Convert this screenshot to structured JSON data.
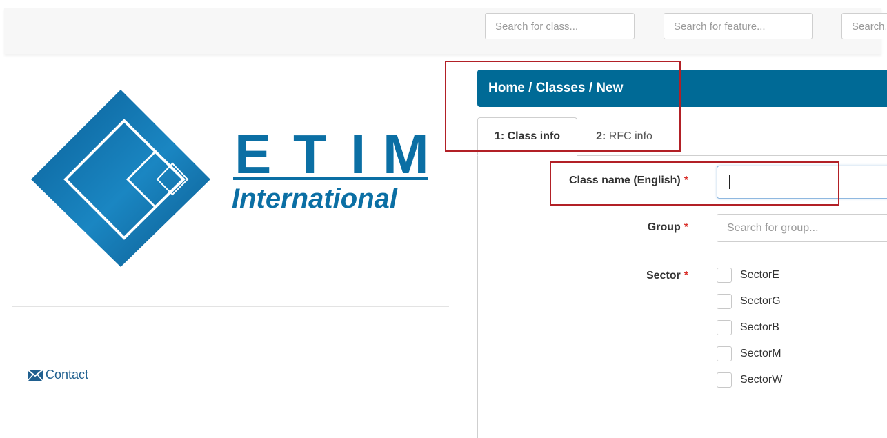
{
  "top_search": {
    "class_placeholder": "Search for class...",
    "feature_placeholder": "Search for feature...",
    "third_placeholder": "Search..."
  },
  "logo": {
    "letters": [
      "E",
      "T",
      "I",
      "M"
    ],
    "subtitle": "International",
    "color": "#0b6fa4"
  },
  "sidebar": {
    "contact_label": "Contact"
  },
  "breadcrumb": "Home / Classes / New",
  "tabs": [
    {
      "num": "1:",
      "label": "Class info"
    },
    {
      "num": "2:",
      "label": "RFC info"
    }
  ],
  "form": {
    "name_label": "Class name (English)",
    "group_label": "Group",
    "group_placeholder": "Search for group...",
    "sector_label": "Sector",
    "required_mark": "*",
    "sectors": [
      "SectorE",
      "SectorG",
      "SectorB",
      "SectorM",
      "SectorW"
    ]
  },
  "colors": {
    "header": "#006a96",
    "required": "#d9302b",
    "annotation": "#b22026"
  }
}
